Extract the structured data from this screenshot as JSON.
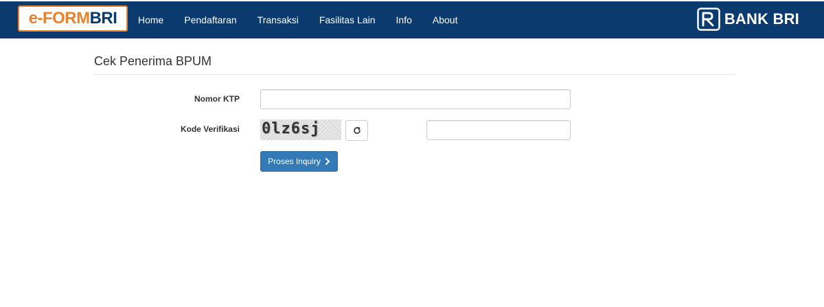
{
  "header": {
    "logo": {
      "part1": "e-FORM",
      "part2": "BRI"
    },
    "nav": [
      "Home",
      "Pendaftaran",
      "Transaksi",
      "Fasilitas Lain",
      "Info",
      "About"
    ],
    "brand": "BANK BRI"
  },
  "page": {
    "title": "Cek Penerima BPUM"
  },
  "form": {
    "ktp_label": "Nomor KTP",
    "ktp_value": "",
    "kode_label": "Kode Verifikasi",
    "captcha_text": "0lz6sj",
    "captcha_input_value": "",
    "submit_label": "Proses Inquiry"
  },
  "colors": {
    "navbar": "#0a3a6e",
    "logo_accent": "#e9822a",
    "primary_button": "#337ab7"
  },
  "icons": [
    "refresh-icon",
    "chevron-right-icon",
    "bri-logo-icon"
  ]
}
